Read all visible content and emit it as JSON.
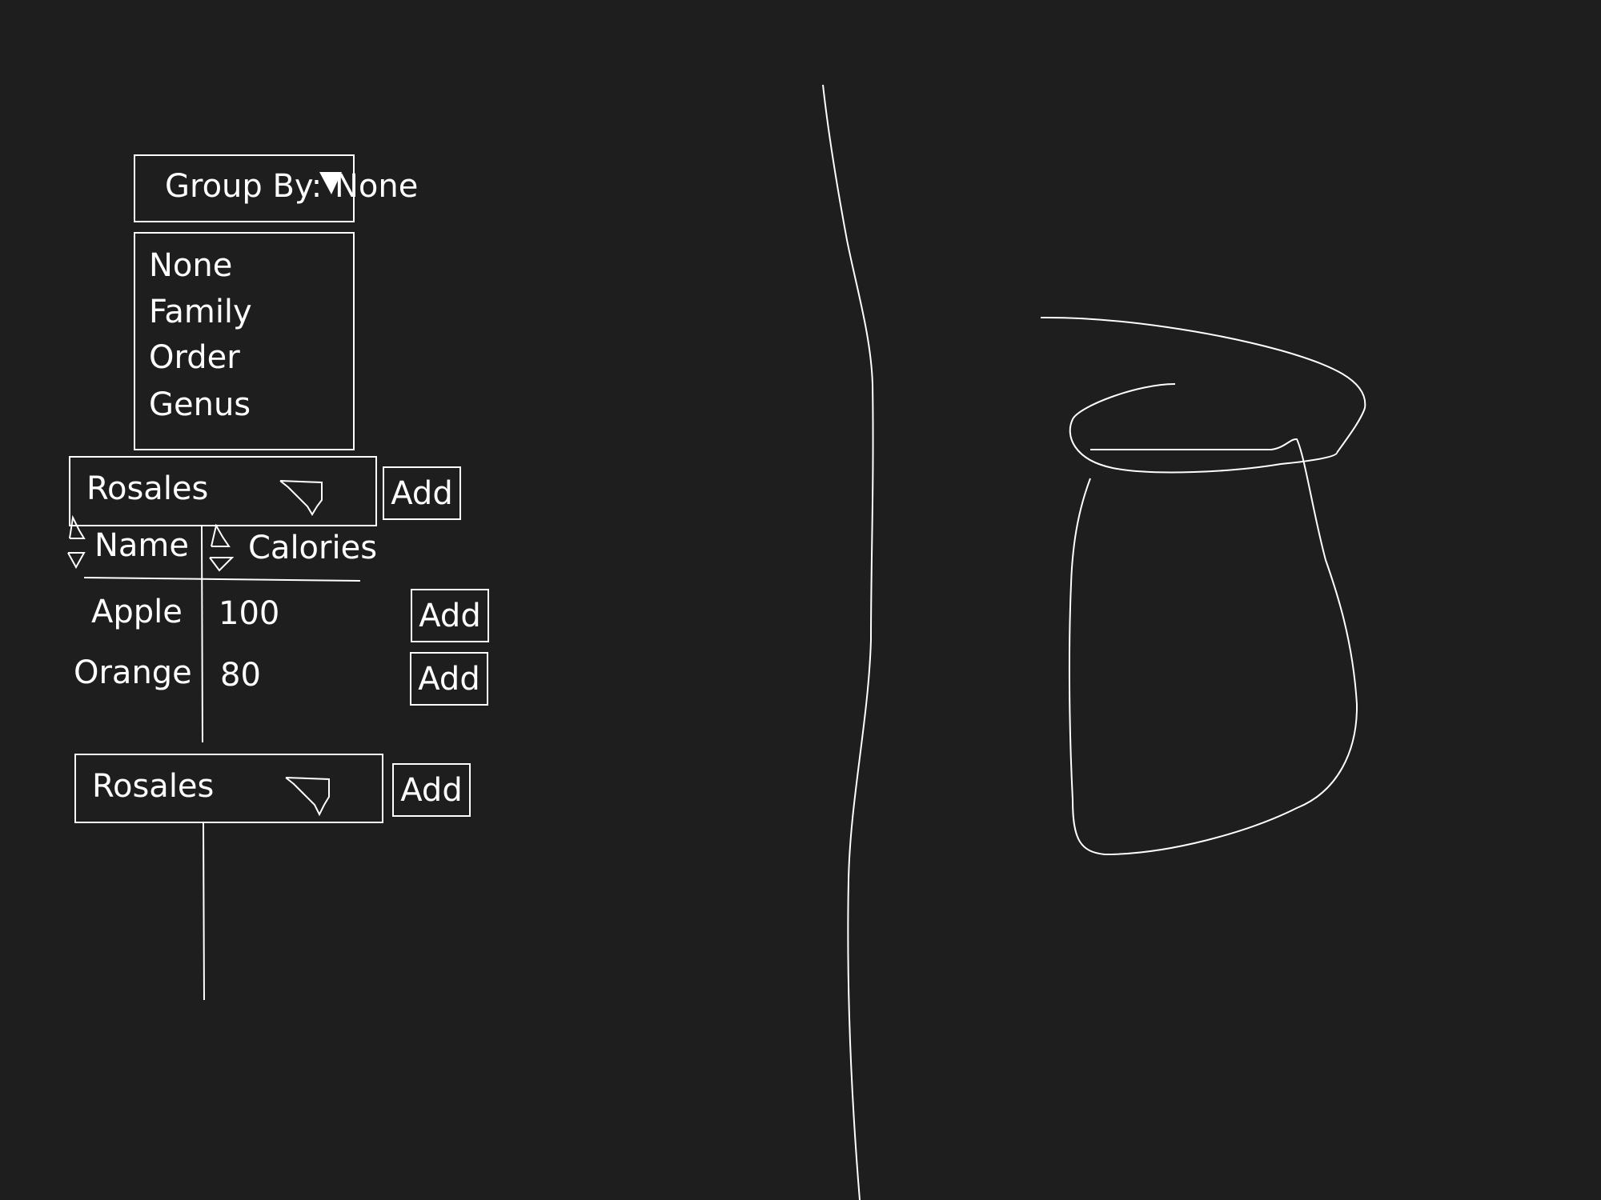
{
  "group_by": {
    "label": "Group By:",
    "value": "None",
    "options": [
      "None",
      "Family",
      "Order",
      "Genus"
    ]
  },
  "groups": [
    {
      "title": "Rosales",
      "add_label": "Add",
      "columns": [
        "Name",
        "Calories"
      ],
      "rows": [
        {
          "name": "Apple",
          "calories": "100",
          "add_label": "Add"
        },
        {
          "name": "Orange",
          "calories": "80",
          "add_label": "Add"
        }
      ]
    },
    {
      "title": "Rosales",
      "add_label": "Add"
    }
  ]
}
